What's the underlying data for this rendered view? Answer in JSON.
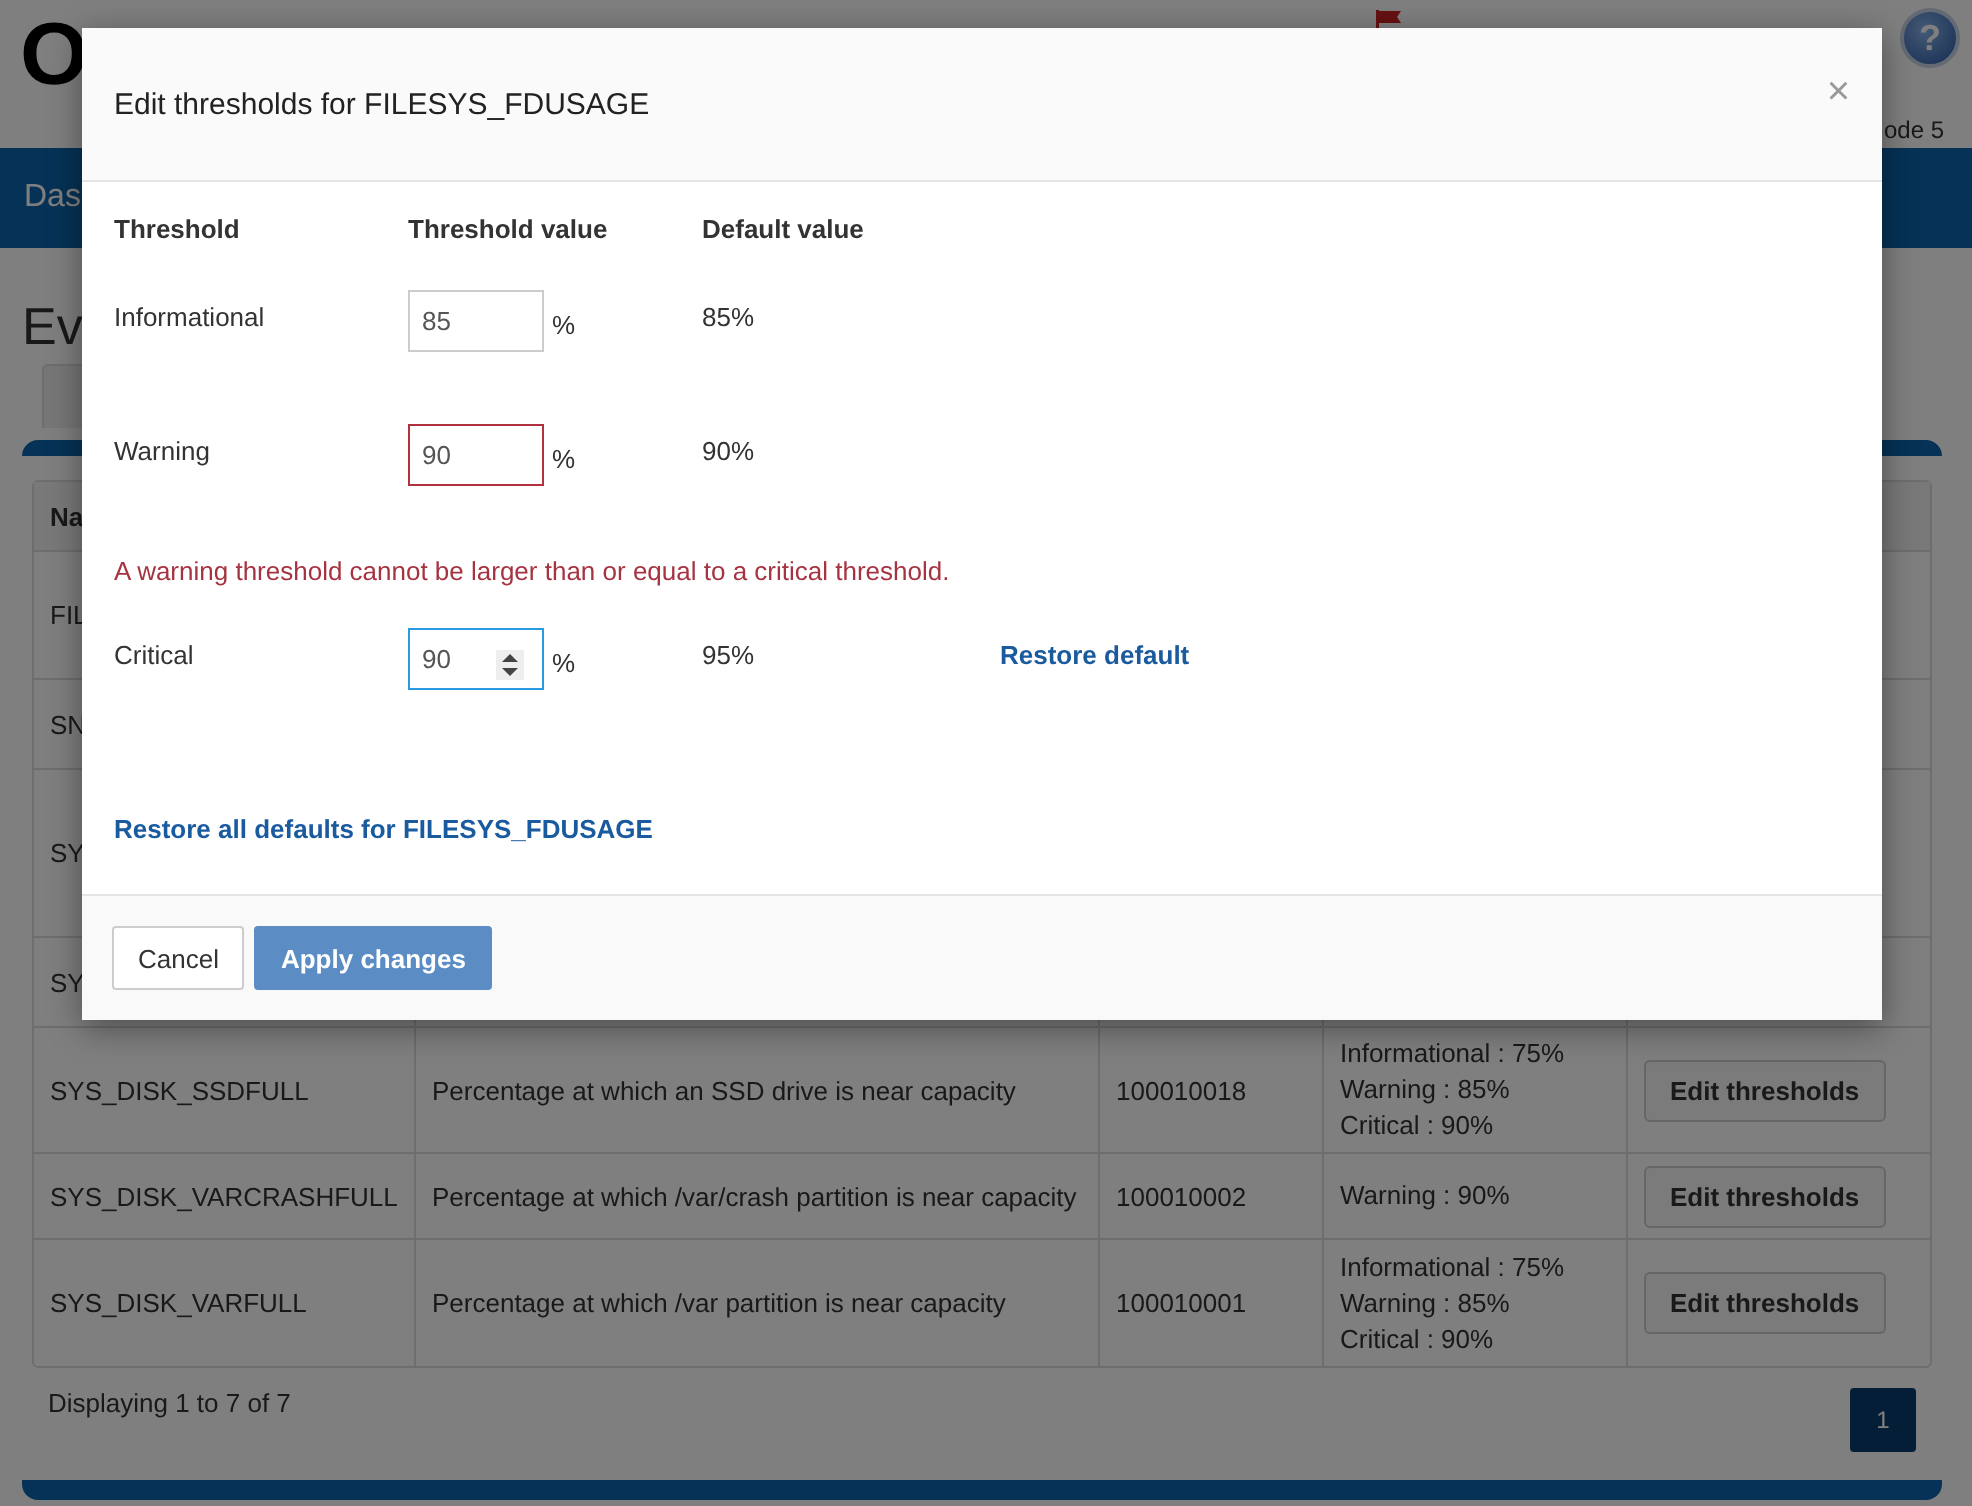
{
  "header": {
    "logo": "O",
    "user_info": "ode 5",
    "help": "?"
  },
  "nav": {
    "items": [
      {
        "label": "Das"
      }
    ]
  },
  "page_title": "Ev",
  "table": {
    "columns": [
      "Na"
    ],
    "rows": [
      {
        "name": "FIL"
      },
      {
        "name": "SN"
      },
      {
        "name": "SY"
      },
      {
        "name": "SY"
      },
      {
        "name": "SYS_DISK_SSDFULL",
        "description": "Percentage at which an SSD drive is near capacity",
        "id": "100010018",
        "thresholds": [
          "Informational : 75%",
          "Warning : 85%",
          "Critical : 90%"
        ],
        "action": "Edit thresholds"
      },
      {
        "name": "SYS_DISK_VARCRASHFULL",
        "description": "Percentage at which /var/crash partition is near capacity",
        "id": "100010002",
        "thresholds": [
          "Warning : 90%"
        ],
        "action": "Edit thresholds"
      },
      {
        "name": "SYS_DISK_VARFULL",
        "description": "Percentage at which /var partition is near capacity",
        "id": "100010001",
        "thresholds": [
          "Informational : 75%",
          "Warning : 85%",
          "Critical : 90%"
        ],
        "action": "Edit thresholds"
      }
    ]
  },
  "footer": {
    "summary": "Displaying 1 to 7 of 7",
    "pages": [
      {
        "label": "1",
        "selected": true
      }
    ]
  },
  "dialog": {
    "title": "Edit thresholds for FILESYS_FDUSAGE",
    "close": "×",
    "columns": [
      "Threshold",
      "Threshold value",
      "Default value"
    ],
    "rows": [
      {
        "label": "Informational",
        "value": "85",
        "unit": "%",
        "default": "85%",
        "invalid": false,
        "focused": false
      },
      {
        "label": "Warning",
        "value": "90",
        "unit": "%",
        "default": "90%",
        "invalid": true,
        "focused": false,
        "error": "A warning threshold cannot be larger than or equal to a critical threshold."
      },
      {
        "label": "Critical",
        "value": "90",
        "unit": "%",
        "default": "95%",
        "invalid": false,
        "focused": true,
        "restore": "Restore default"
      }
    ],
    "restore_all": "Restore all defaults for FILESYS_FDUSAGE",
    "buttons": [
      {
        "label": "Cancel",
        "kind": "default"
      },
      {
        "label": "Apply changes",
        "kind": "primary"
      }
    ]
  }
}
